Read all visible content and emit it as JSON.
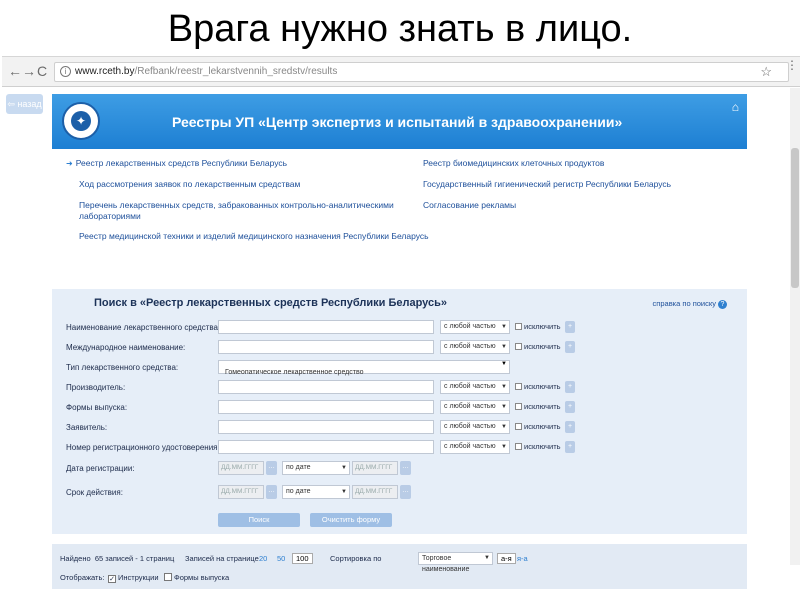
{
  "slide": {
    "title": "Врага нужно знать в лицо."
  },
  "browser": {
    "url_domain": "www.rceth.by",
    "url_path": "/Refbank/reestr_lekarstvennih_sredstv/results"
  },
  "page": {
    "back_button": "⇦ назад",
    "header_title": "Реестры УП «Центр экспертиз и испытаний в здравоохранении»",
    "left_links": [
      "Реестр лекарственных средств Республики Беларусь",
      "Ход рассмотрения заявок по лекарственным средствам",
      "Перечень лекарственных средств, забракованных контрольно-аналитическими",
      "лабораториями",
      "Реестр медицинской техники и изделий медицинского назначения Республики Беларусь"
    ],
    "right_links": [
      "Реестр биомедицинских клеточных продуктов",
      "Государственный гигиенический регистр Республики Беларусь",
      "Согласование рекламы"
    ],
    "search": {
      "title": "Поиск в «Реестр лекарственных средств Республики Беларусь»",
      "help": "справка по поиску",
      "fields": [
        {
          "label": "Наименование лекарственного средства:",
          "value": "",
          "mode": "с любой частью",
          "exclude": "исключить"
        },
        {
          "label": "Международное наименование:",
          "value": "",
          "mode": "с любой частью",
          "exclude": "исключить"
        },
        {
          "label": "Тип лекарственного средства:",
          "value": "Гомеопатическое лекарственное средство"
        },
        {
          "label": "Производитель:",
          "value": "",
          "mode": "с любой частью",
          "exclude": "исключить"
        },
        {
          "label": "Формы выпуска:",
          "value": "",
          "mode": "с любой частью",
          "exclude": "исключить"
        },
        {
          "label": "Заявитель:",
          "value": "",
          "mode": "с любой частью",
          "exclude": "исключить"
        },
        {
          "label": "Номер регистрационного удостоверения:",
          "value": "",
          "mode": "с любой частью",
          "exclude": "исключить"
        }
      ],
      "date_fields": [
        {
          "label": "Дата регистрации:",
          "from_placeholder": "ДД.ММ.ГГГГ",
          "mode": "по дате",
          "to_placeholder": "ДД.ММ.ГГГГ"
        },
        {
          "label": "Срок действия:",
          "from_placeholder": "ДД.ММ.ГГГГ",
          "mode": "по дате",
          "to_placeholder": "ДД.ММ.ГГГГ"
        }
      ],
      "search_button": "Поиск",
      "clear_button": "Очистить форму"
    },
    "results": {
      "found_label": "Найдено",
      "found_text": "65 записей - 1 страниц",
      "per_page_label": "Записей на странице",
      "per_page_options": [
        "20",
        "50",
        "100"
      ],
      "sort_label": "Сортировка по",
      "sort_value": "Торговое наименование",
      "sort_asc": "а-я",
      "sort_desc": "я-а",
      "display_label": "Отображать:",
      "display_options": [
        "Инструкции",
        "Формы выпуска"
      ]
    }
  }
}
